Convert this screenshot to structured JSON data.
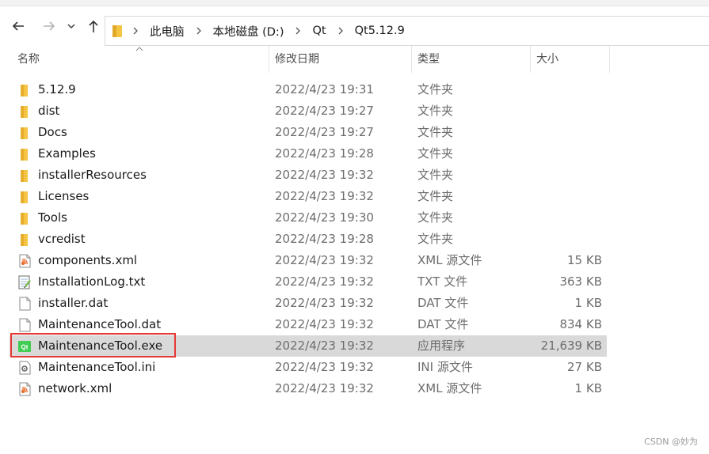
{
  "navigation": {
    "back_icon": "arrow-left-icon",
    "forward_icon": "arrow-right-icon",
    "recent_icon": "chevron-down-icon",
    "up_icon": "arrow-up-icon"
  },
  "address_bar": {
    "folder_icon": "folder-icon",
    "crumbs": [
      "此电脑",
      "本地磁盘 (D:)",
      "Qt",
      "Qt5.12.9"
    ]
  },
  "columns": {
    "name": "名称",
    "date": "修改日期",
    "type": "类型",
    "size": "大小"
  },
  "files": [
    {
      "name": "5.12.9",
      "date": "2022/4/23 19:31",
      "type": "文件夹",
      "size": "",
      "icon": "folder-icon"
    },
    {
      "name": "dist",
      "date": "2022/4/23 19:27",
      "type": "文件夹",
      "size": "",
      "icon": "folder-icon"
    },
    {
      "name": "Docs",
      "date": "2022/4/23 19:27",
      "type": "文件夹",
      "size": "",
      "icon": "folder-icon"
    },
    {
      "name": "Examples",
      "date": "2022/4/23 19:28",
      "type": "文件夹",
      "size": "",
      "icon": "folder-icon"
    },
    {
      "name": "installerResources",
      "date": "2022/4/23 19:32",
      "type": "文件夹",
      "size": "",
      "icon": "folder-icon"
    },
    {
      "name": "Licenses",
      "date": "2022/4/23 19:32",
      "type": "文件夹",
      "size": "",
      "icon": "folder-icon"
    },
    {
      "name": "Tools",
      "date": "2022/4/23 19:30",
      "type": "文件夹",
      "size": "",
      "icon": "folder-icon"
    },
    {
      "name": "vcredist",
      "date": "2022/4/23 19:28",
      "type": "文件夹",
      "size": "",
      "icon": "folder-icon"
    },
    {
      "name": "components.xml",
      "date": "2022/4/23 19:32",
      "type": "XML 源文件",
      "size": "15 KB",
      "icon": "xml-file-icon"
    },
    {
      "name": "InstallationLog.txt",
      "date": "2022/4/23 19:32",
      "type": "TXT 文件",
      "size": "363 KB",
      "icon": "text-file-icon"
    },
    {
      "name": "installer.dat",
      "date": "2022/4/23 19:32",
      "type": "DAT 文件",
      "size": "1 KB",
      "icon": "file-icon"
    },
    {
      "name": "MaintenanceTool.dat",
      "date": "2022/4/23 19:32",
      "type": "DAT 文件",
      "size": "834 KB",
      "icon": "file-icon"
    },
    {
      "name": "MaintenanceTool.exe",
      "date": "2022/4/23 19:32",
      "type": "应用程序",
      "size": "21,639 KB",
      "icon": "qt-app-icon",
      "selected": true
    },
    {
      "name": "MaintenanceTool.ini",
      "date": "2022/4/23 19:32",
      "type": "INI 源文件",
      "size": "27 KB",
      "icon": "ini-file-icon"
    },
    {
      "name": "network.xml",
      "date": "2022/4/23 19:32",
      "type": "XML 源文件",
      "size": "1 KB",
      "icon": "xml-file-icon"
    }
  ],
  "watermark": "CSDN @妙为",
  "colors": {
    "selected_row": "#d9d9d9",
    "highlight_box": "#e53935",
    "folder": "#f5c443",
    "qt_green": "#41cd52"
  }
}
